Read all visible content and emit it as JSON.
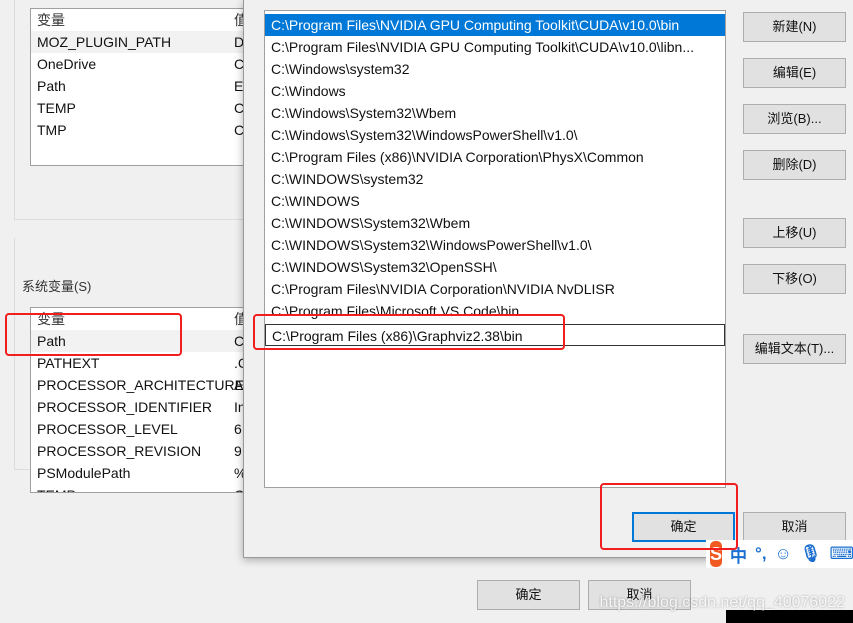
{
  "user_vars": {
    "header": "变量",
    "header2": "值",
    "rows": [
      {
        "name": "MOZ_PLUGIN_PATH",
        "value": "D"
      },
      {
        "name": "OneDrive",
        "value": "C"
      },
      {
        "name": "Path",
        "value": "E"
      },
      {
        "name": "TEMP",
        "value": "C"
      },
      {
        "name": "TMP",
        "value": "C"
      }
    ]
  },
  "system_vars": {
    "label": "系统变量(S)",
    "header": "变量",
    "header2": "值",
    "rows": [
      {
        "name": "Path",
        "value": "C"
      },
      {
        "name": "PATHEXT",
        "value": ".C"
      },
      {
        "name": "PROCESSOR_ARCHITECTURE",
        "value": "A"
      },
      {
        "name": "PROCESSOR_IDENTIFIER",
        "value": "In"
      },
      {
        "name": "PROCESSOR_LEVEL",
        "value": "6"
      },
      {
        "name": "PROCESSOR_REVISION",
        "value": "9"
      },
      {
        "name": "PSModulePath",
        "value": "%"
      },
      {
        "name": "TEMP",
        "value": "C"
      }
    ]
  },
  "main_buttons": {
    "ok": "确定",
    "cancel": "取消"
  },
  "edit_dialog": {
    "paths": [
      "C:\\Program Files\\NVIDIA GPU Computing Toolkit\\CUDA\\v10.0\\bin",
      "C:\\Program Files\\NVIDIA GPU Computing Toolkit\\CUDA\\v10.0\\libn...",
      "C:\\Windows\\system32",
      "C:\\Windows",
      "C:\\Windows\\System32\\Wbem",
      "C:\\Windows\\System32\\WindowsPowerShell\\v1.0\\",
      "C:\\Program Files (x86)\\NVIDIA Corporation\\PhysX\\Common",
      "C:\\WINDOWS\\system32",
      "C:\\WINDOWS",
      "C:\\WINDOWS\\System32\\Wbem",
      "C:\\WINDOWS\\System32\\WindowsPowerShell\\v1.0\\",
      "C:\\WINDOWS\\System32\\OpenSSH\\",
      "C:\\Program Files\\NVIDIA Corporation\\NVIDIA NvDLISR",
      "C:\\Program Files\\Microsoft VS Code\\bin",
      "C:\\Program Files (x86)\\Graphviz2.38\\bin"
    ],
    "buttons": {
      "new": "新建(N)",
      "edit": "编辑(E)",
      "browse": "浏览(B)...",
      "delete": "删除(D)",
      "up": "上移(U)",
      "down": "下移(O)",
      "edit_text": "编辑文本(T)...",
      "ok": "确定",
      "cancel": "取消"
    }
  },
  "ime": {
    "lang": "中",
    "punct": "°,"
  },
  "watermark": "https://blog.csdn.net/qq_40076022",
  "colors": {
    "selection": "#0078d7",
    "highlight_box": "#f01e1e"
  }
}
